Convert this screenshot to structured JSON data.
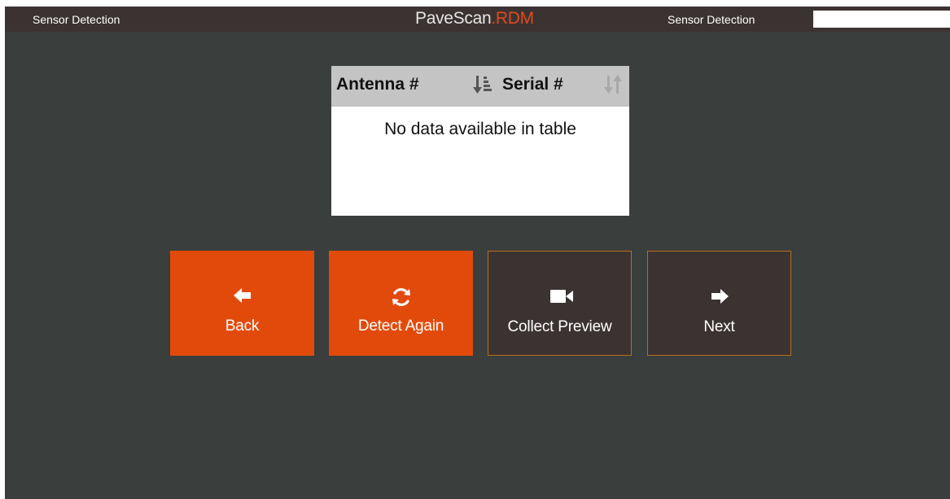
{
  "header": {
    "title_left": "Sensor Detection",
    "brand_part1": "PaveScan",
    "brand_part2": ".RDM",
    "title_right": "Sensor Detection",
    "search_value": ""
  },
  "table": {
    "columns": [
      {
        "label": "Antenna #",
        "sort_icon": "sort-descending-icon"
      },
      {
        "label": "Serial #",
        "sort_icon": "sort-neutral-icon"
      }
    ],
    "empty_message": "No data available in table"
  },
  "buttons": {
    "back": {
      "label": "Back",
      "icon": "arrow-left-icon"
    },
    "detect_again": {
      "label": "Detect Again",
      "icon": "refresh-icon"
    },
    "collect_preview": {
      "label": "Collect Preview",
      "icon": "video-camera-icon"
    },
    "next": {
      "label": "Next",
      "icon": "arrow-right-icon"
    }
  },
  "colors": {
    "background": "#3a3e3c",
    "topbar": "#3b3331",
    "accent_orange": "#e24a0c",
    "brand_orange": "#e2491c",
    "outline_gold": "#b5701f",
    "table_header": "#c4c4c4"
  }
}
